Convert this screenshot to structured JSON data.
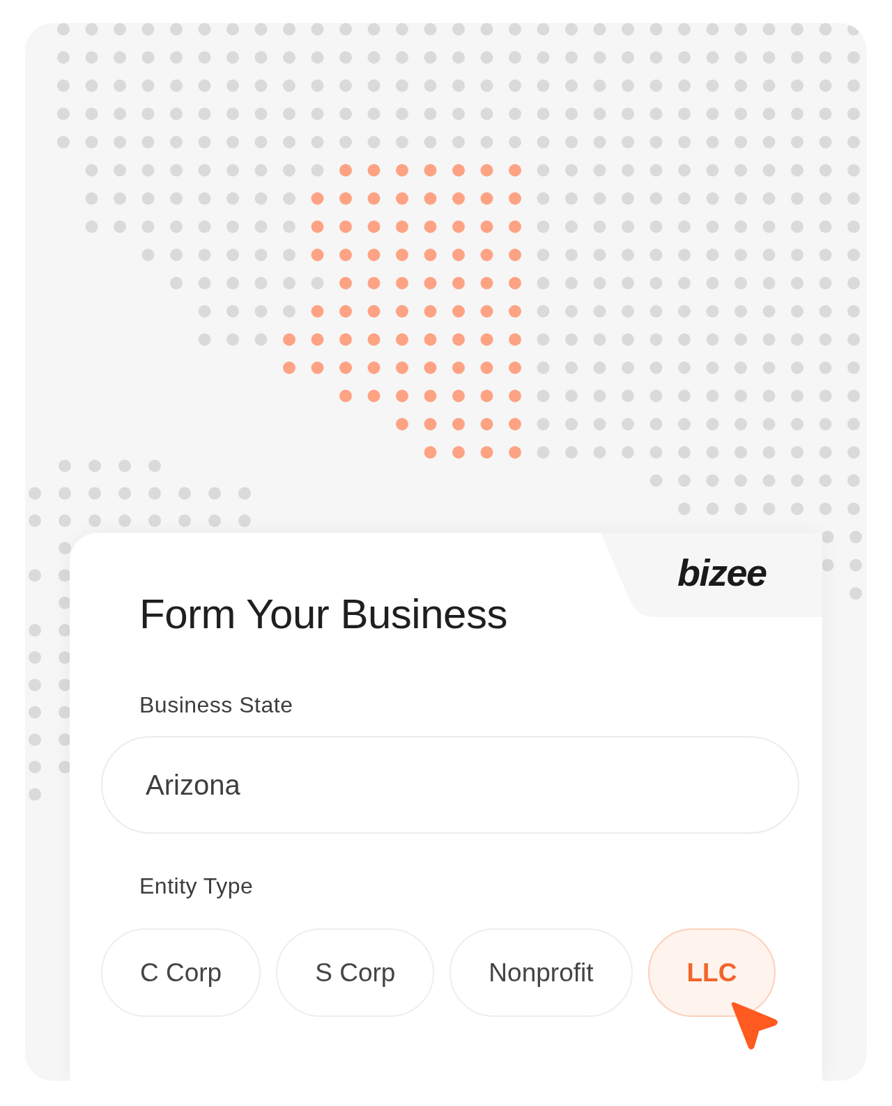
{
  "logo": "bizee",
  "title": "Form Your Business",
  "business_state": {
    "label": "Business State",
    "value": "Arizona"
  },
  "entity_type": {
    "label": "Entity Type",
    "options": [
      {
        "label": "C Corp",
        "selected": false
      },
      {
        "label": "S Corp",
        "selected": false
      },
      {
        "label": "Nonprofit",
        "selected": false
      },
      {
        "label": "LLC",
        "selected": true
      }
    ]
  }
}
